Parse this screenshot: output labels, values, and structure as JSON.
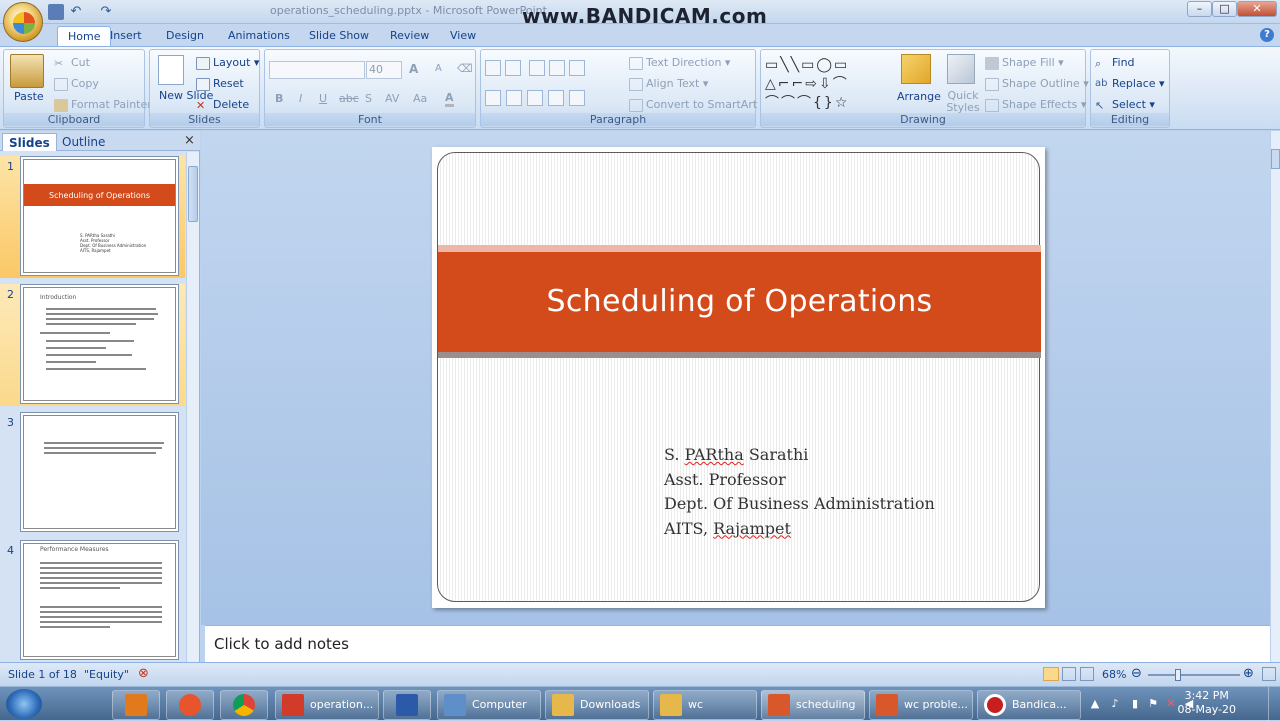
{
  "window": {
    "title": "operations_scheduling.pptx - Microsoft PowerPoint",
    "watermark": "www.BANDICAM.com",
    "min": "–",
    "max": "□",
    "close": "✕"
  },
  "tabs": [
    "Home",
    "Insert",
    "Design",
    "Animations",
    "Slide Show",
    "Review",
    "View"
  ],
  "ribbon": {
    "clipboard": {
      "label": "Clipboard",
      "paste": "Paste",
      "cut": "Cut",
      "copy": "Copy",
      "format_painter": "Format Painter"
    },
    "slides": {
      "label": "Slides",
      "new_slide": "New Slide",
      "layout": "Layout",
      "reset": "Reset",
      "delete": "Delete"
    },
    "font": {
      "label": "Font",
      "font_size": "40",
      "bold": "B",
      "italic": "I",
      "underline": "U",
      "strike": "abc",
      "shadow": "S",
      "spacing": "AV",
      "case": "Aa",
      "color": "A",
      "grow": "A",
      "shrink": "A"
    },
    "paragraph": {
      "label": "Paragraph",
      "text_direction": "Text Direction",
      "align_text": "Align Text",
      "convert": "Convert to SmartArt"
    },
    "drawing": {
      "label": "Drawing",
      "arrange": "Arrange",
      "quick_styles": "Quick Styles",
      "shape_fill": "Shape Fill",
      "shape_outline": "Shape Outline",
      "shape_effects": "Shape Effects"
    },
    "editing": {
      "label": "Editing",
      "find": "Find",
      "replace": "Replace",
      "select": "Select"
    }
  },
  "pane": {
    "tabs": [
      "Slides",
      "Outline"
    ],
    "close": "×",
    "thumbs": [
      {
        "num": "1",
        "title": "Scheduling of Operations",
        "lines": [
          "S. PARtha Sarathi",
          "Asst. Professor",
          "Dept. Of Business Administration",
          "AITS, Rajampet"
        ]
      },
      {
        "num": "2",
        "title": "Introduction"
      },
      {
        "num": "3",
        "title": ""
      },
      {
        "num": "4",
        "title": "Performance Measures"
      }
    ]
  },
  "slide": {
    "title": "Scheduling of Operations",
    "subtitle": [
      {
        "pre": "S. ",
        "squig": "PARtha",
        "post": " Sarathi"
      },
      {
        "pre": "Asst. Professor",
        "squig": "",
        "post": ""
      },
      {
        "pre": "Dept. Of Business Administration",
        "squig": "",
        "post": ""
      },
      {
        "pre": "AITS, ",
        "squig": "Rajampet",
        "post": ""
      }
    ]
  },
  "notes": {
    "placeholder": "Click to add notes"
  },
  "status": {
    "slide": "Slide 1 of 18",
    "theme": "\"Equity\"",
    "zoom": "68%"
  },
  "taskbar": {
    "items": [
      {
        "label": "",
        "color": "#3a8ad6"
      },
      {
        "label": "",
        "color": "#e07a1c"
      },
      {
        "label": "",
        "color": "#e8542c"
      },
      {
        "label": "",
        "color": "#3aa655"
      },
      {
        "label": "operation...",
        "color": "#d23a2a"
      },
      {
        "label": "",
        "color": "#2b5ba8"
      },
      {
        "label": "Computer",
        "color": "#5f8fc9"
      },
      {
        "label": "Downloads",
        "color": "#e6b84c"
      },
      {
        "label": "wc",
        "color": "#e6b84c"
      },
      {
        "label": "scheduling",
        "color": "#d9582b"
      },
      {
        "label": "wc proble...",
        "color": "#d9582b"
      },
      {
        "label": "Bandica...",
        "color": "#c81e1e"
      }
    ],
    "time": "3:42 PM",
    "date": "08-May-20"
  },
  "colors": {
    "accent": "#d34a1b",
    "ribbon": "#dbe7f6"
  }
}
